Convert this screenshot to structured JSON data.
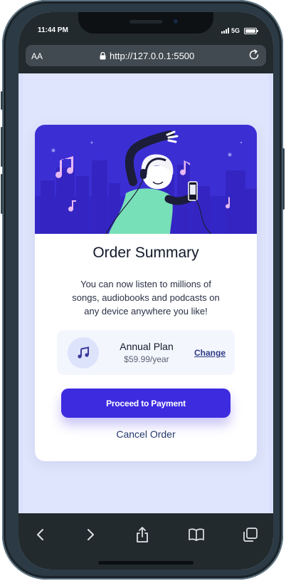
{
  "status_bar": {
    "time": "11:44 PM",
    "network": "5G"
  },
  "browser": {
    "text_size_label": "AA",
    "url": "http://127.0.0.1:5500",
    "icons": [
      "lock-icon",
      "reload-icon",
      "back-icon",
      "forward-icon",
      "share-icon",
      "bookmarks-icon",
      "tabs-icon"
    ]
  },
  "order": {
    "title": "Order Summary",
    "description": "You can now listen to millions of songs, audiobooks and podcasts on any device anywhere you like!",
    "plan": {
      "icon": "music-note-icon",
      "name": "Annual Plan",
      "price": "$59.99/year",
      "change_label": "Change"
    },
    "proceed_label": "Proceed to Payment",
    "cancel_label": "Cancel Order"
  },
  "colors": {
    "accent": "#3d2be0",
    "hero_bg": "#3b2fd4",
    "page_bg": "#dfe5fc",
    "card_bg": "#ffffff",
    "plan_bg": "#f4f6fe",
    "link": "#2e3a86"
  }
}
